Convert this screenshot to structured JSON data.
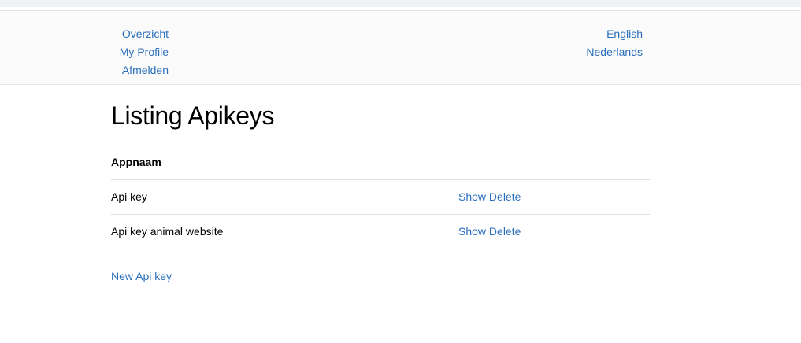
{
  "nav": {
    "left_links": [
      "Overzicht",
      "My Profile",
      "Afmelden"
    ],
    "right_links": [
      "English",
      "Nederlands"
    ]
  },
  "page": {
    "title": "Listing Apikeys"
  },
  "table": {
    "header": "Appnaam",
    "rows": [
      {
        "name": "Api key",
        "show_label": "Show",
        "delete_label": "Delete"
      },
      {
        "name": "Api key animal website",
        "show_label": "Show",
        "delete_label": "Delete"
      }
    ]
  },
  "actions": {
    "new_label": "New Api key"
  },
  "colors": {
    "link": "#2a6ebb",
    "navbar_bg": "#fbfbfb",
    "border": "#dedede"
  }
}
